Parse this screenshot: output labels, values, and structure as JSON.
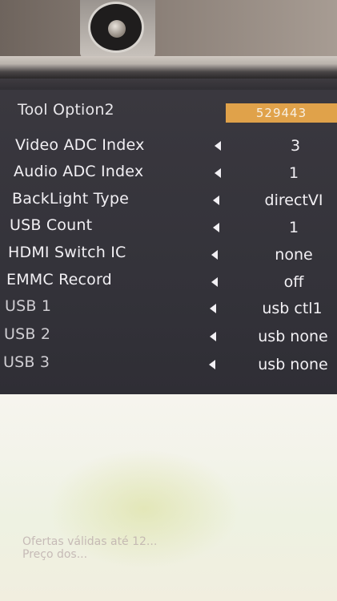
{
  "menu": {
    "title": "Tool Option2",
    "title_value": "529443",
    "items": [
      {
        "label": "Video ADC Index",
        "value": "3"
      },
      {
        "label": "Audio ADC Index",
        "value": "1"
      },
      {
        "label": "BackLight Type",
        "value": "directVI"
      },
      {
        "label": "USB Count",
        "value": "1"
      },
      {
        "label": "HDMI Switch IC",
        "value": "none"
      },
      {
        "label": "EMMC Record",
        "value": "off"
      },
      {
        "label": "USB 1",
        "value": "usb ctl1"
      },
      {
        "label": "USB 2",
        "value": "usb none"
      },
      {
        "label": "USB 3",
        "value": "usb none"
      }
    ]
  },
  "background_text": {
    "line1": "Ofertas válidas até 12...",
    "line2": "Preço dos..."
  },
  "colors": {
    "osd_background": "#36343b",
    "title_value_background": "#e0a24a",
    "text": "#f2f0f4"
  }
}
